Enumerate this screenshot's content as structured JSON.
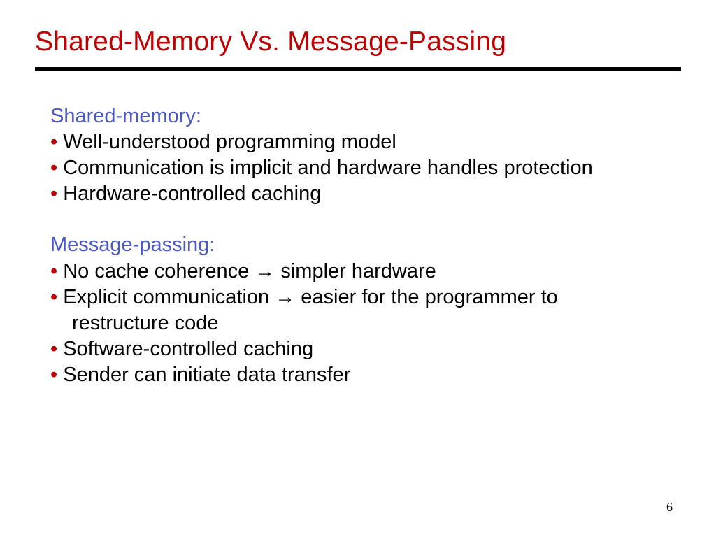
{
  "title": "Shared-Memory Vs. Message-Passing",
  "arrow": "→",
  "sections": [
    {
      "heading": "Shared-memory:",
      "bullets": [
        {
          "pre": "Well-understood programming model",
          "post": "",
          "cont": ""
        },
        {
          "pre": "Communication is implicit and hardware handles protection",
          "post": "",
          "cont": ""
        },
        {
          "pre": "Hardware-controlled caching",
          "post": "",
          "cont": ""
        }
      ]
    },
    {
      "heading": "Message-passing:",
      "bullets": [
        {
          "pre": "No cache coherence ",
          "post": " simpler hardware",
          "cont": ""
        },
        {
          "pre": "Explicit communication ",
          "post": " easier for the programmer to",
          "cont": "restructure code"
        },
        {
          "pre": "Software-controlled caching",
          "post": "",
          "cont": ""
        },
        {
          "pre": "Sender can initiate data transfer",
          "post": "",
          "cont": ""
        }
      ]
    }
  ],
  "page_number": "6"
}
